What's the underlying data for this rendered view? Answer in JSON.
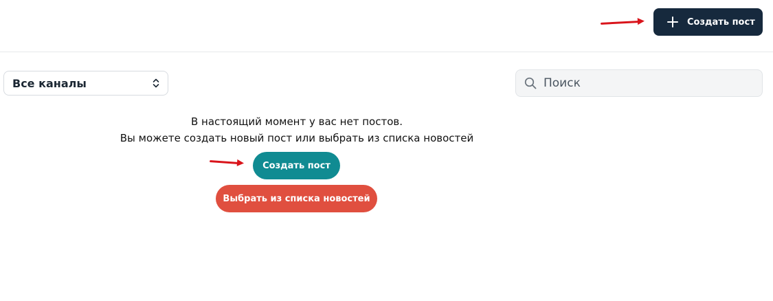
{
  "header": {
    "create_post_label": "Создать пост",
    "icon": "plus-icon",
    "button_color": "#16293d"
  },
  "toolbar": {
    "channel_select": {
      "selected": "Все каналы",
      "icon": "chevron-up-down-icon"
    },
    "search": {
      "placeholder": "Поиск",
      "value": "",
      "icon": "search-icon"
    }
  },
  "empty_state": {
    "line1": "В настоящий момент у вас нет постов.",
    "line2": "Вы можете создать новый пост или выбрать из списка новостей",
    "create_post_label": "Создать пост",
    "create_post_color": "#108b92",
    "choose_news_label": "Выбрать из списка новостей",
    "choose_news_color": "#e04f3f"
  },
  "annotations": {
    "arrow_color": "#d9141b"
  }
}
